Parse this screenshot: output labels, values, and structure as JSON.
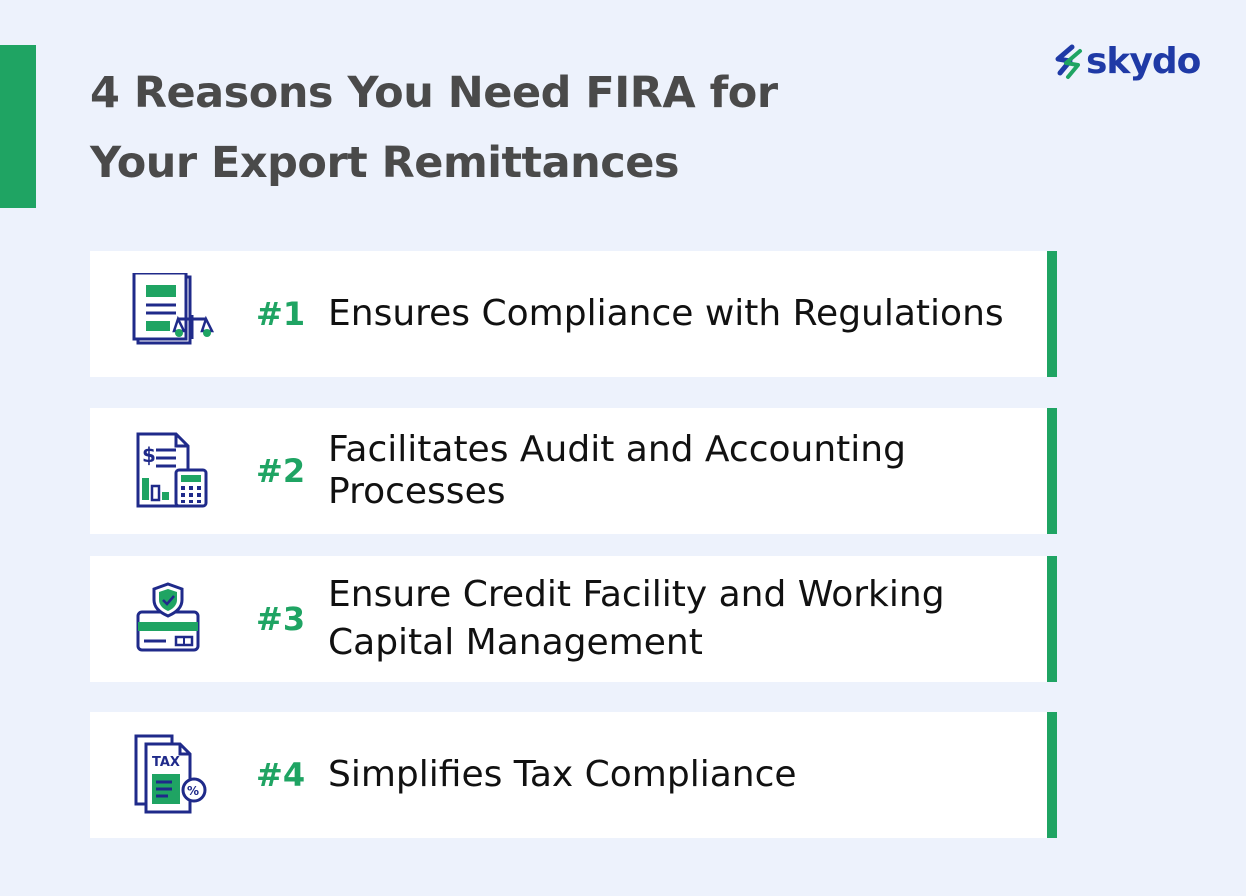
{
  "title": {
    "line1": "4 Reasons You Need FIRA for",
    "line2": "Your Export Remittances"
  },
  "brand": {
    "name": "skydo",
    "icon": "skydo-logo-icon"
  },
  "colors": {
    "accent": "#1fa463",
    "navy": "#1f2a8a",
    "brand_blue": "#1f3aa6",
    "background": "#edf2fc"
  },
  "reasons": [
    {
      "number": "#1",
      "lines": [
        "Ensures Compliance with Regulations"
      ],
      "icon": "document-scales-icon"
    },
    {
      "number": "#2",
      "lines": [
        "Facilitates Audit and Accounting",
        "Processes"
      ],
      "icon": "invoice-calculator-icon"
    },
    {
      "number": "#3",
      "lines": [
        "Ensure Credit Facility and Working",
        "Capital Management"
      ],
      "icon": "credit-card-shield-icon"
    },
    {
      "number": "#4",
      "lines": [
        "Simplifies Tax Compliance"
      ],
      "icon": "tax-document-icon"
    }
  ]
}
